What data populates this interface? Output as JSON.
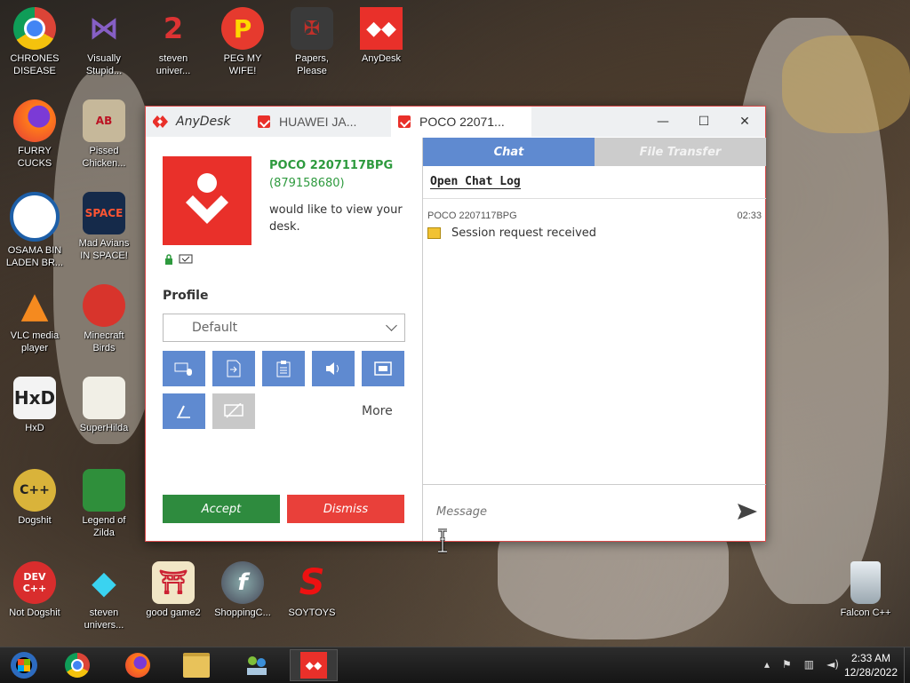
{
  "desktop": {
    "icons": [
      {
        "label": "CHRONES\nDISEASE"
      },
      {
        "label": "Visually\nStupid..."
      },
      {
        "label": "steven\nuniver..."
      },
      {
        "label": "PEG MY WIFE!"
      },
      {
        "label": "Papers,\nPlease"
      },
      {
        "label": "AnyDesk"
      },
      {
        "label": "FURRY CUCKS"
      },
      {
        "label": "Pissed\nChicken..."
      },
      {
        "label": "OSAMA BIN\nLADEN BR..."
      },
      {
        "label": "Mad Avians\nIN SPACE!"
      },
      {
        "label": "VLC media\nplayer"
      },
      {
        "label": "Minecraft\nBirds"
      },
      {
        "label": "HxD"
      },
      {
        "label": "SuperHilda"
      },
      {
        "label": "Dogshit"
      },
      {
        "label": "Legend of\nZilda"
      },
      {
        "label": "Not Dogshit"
      },
      {
        "label": "steven\nunivers..."
      },
      {
        "label": "good game2"
      },
      {
        "label": "ShoppingC..."
      },
      {
        "label": "SOYTOYS"
      },
      {
        "label": "Falcon C++"
      }
    ]
  },
  "window": {
    "app_name": "AnyDesk",
    "tabs": [
      {
        "label": "HUAWEI JA..."
      },
      {
        "label": "POCO 22071..."
      }
    ],
    "controls": {
      "minimize": "—",
      "maximize": "☐",
      "close": "✕"
    },
    "request": {
      "device_name": "POCO 2207117BPG",
      "device_id": "(879158680)",
      "message": "would like to view your desk."
    },
    "profile": {
      "label": "Profile",
      "selected": "Default"
    },
    "permissions": [
      "keyboard-mouse",
      "file-manager",
      "clipboard",
      "audio",
      "screen",
      "draw",
      "privacy-mode"
    ],
    "more_label": "More",
    "accept_label": "Accept",
    "dismiss_label": "Dismiss",
    "chat": {
      "tab_chat": "Chat",
      "tab_file_transfer": "File Transfer",
      "open_log": "Open Chat Log",
      "messages": [
        {
          "sender": "POCO 2207117BPG",
          "time": "02:33",
          "text": "Session request received"
        }
      ],
      "input_placeholder": "Message"
    }
  },
  "taskbar": {
    "clock_time": "2:33 AM",
    "clock_date": "12/28/2022"
  },
  "colors": {
    "anydesk_red": "#e9302a",
    "accept_green": "#2e8b3e",
    "permission_blue": "#5f8ad0",
    "device_green": "#2e9a3e"
  }
}
